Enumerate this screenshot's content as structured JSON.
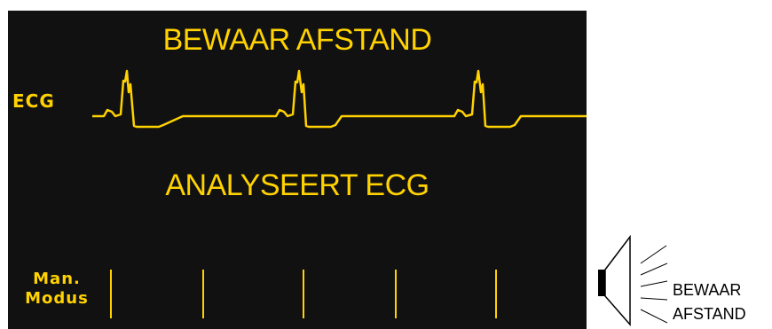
{
  "screen": {
    "top_message": "BEWAAR AFSTAND",
    "middle_message": "ANALYSEERT ECG",
    "ecg_label": "ECG",
    "waveform": {
      "name": "ECG",
      "beats": 3
    },
    "softkeys": [
      {
        "line1": "Man.",
        "line2": "Modus"
      },
      {
        "line1": "",
        "line2": ""
      },
      {
        "line1": "",
        "line2": ""
      },
      {
        "line1": "",
        "line2": ""
      },
      {
        "line1": "",
        "line2": ""
      },
      {
        "line1": "",
        "line2": ""
      }
    ],
    "colors": {
      "text": "#ffd200",
      "background": "#111111"
    }
  },
  "voice_prompt": {
    "icon": "speaker-icon",
    "line1": "BEWAAR",
    "line2": "AFSTAND"
  }
}
